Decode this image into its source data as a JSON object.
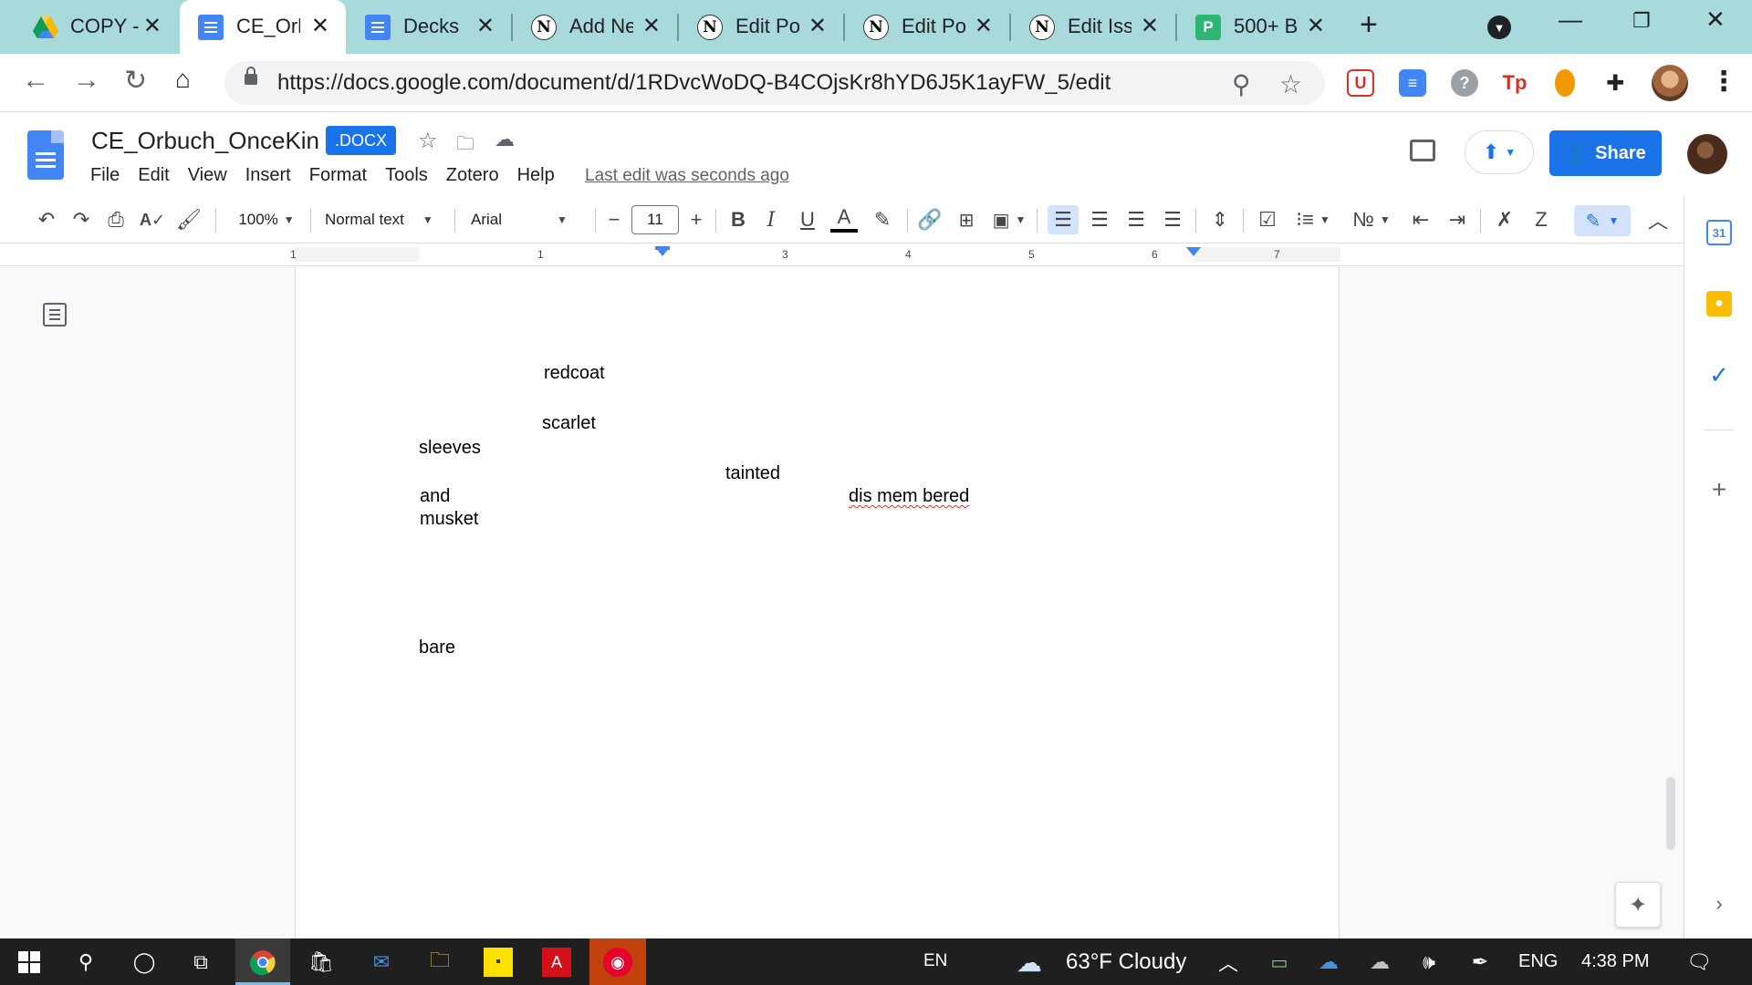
{
  "browser": {
    "tabs": [
      {
        "title": "COPY -",
        "icon": "google-drive-icon"
      },
      {
        "title": "CE_Orb",
        "icon": "google-docs-icon",
        "active": true
      },
      {
        "title": "Decks",
        "icon": "google-docs-icon"
      },
      {
        "title": "Add Ne",
        "icon": "n-icon"
      },
      {
        "title": "Edit Pos",
        "icon": "n-icon"
      },
      {
        "title": "Edit Pos",
        "icon": "n-icon"
      },
      {
        "title": "Edit Iss",
        "icon": "n-icon"
      },
      {
        "title": "500+ B",
        "icon": "p-icon"
      }
    ],
    "url": "https://docs.google.com/document/d/1RDvcWoDQ-B4COjsKr8hYD6J5K1ayFW_5/edit"
  },
  "docs": {
    "title": "CE_Orbuch_OnceKin",
    "badge": ".DOCX",
    "menu": [
      "File",
      "Edit",
      "View",
      "Insert",
      "Format",
      "Tools",
      "Zotero",
      "Help"
    ],
    "last_edit": "Last edit was seconds ago",
    "share_label": "Share"
  },
  "toolbar": {
    "zoom": "100%",
    "style": "Normal text",
    "font": "Arial",
    "font_size": "11"
  },
  "ruler": {
    "labels": [
      "1",
      "1",
      "3",
      "4",
      "5",
      "6",
      "7"
    ]
  },
  "document": {
    "words": [
      "redcoat",
      "scarlet",
      "sleeves",
      "tainted",
      "and",
      "dis mem bered",
      "musket",
      "bare"
    ]
  },
  "taskbar": {
    "lang_short": "EN",
    "weather": "63°F  Cloudy",
    "lang": "ENG",
    "time": "4:38 PM"
  },
  "colors": {
    "tab_strip": "#a8dadb",
    "accent": "#1a73e8",
    "taskbar": "#1f1f1f"
  }
}
